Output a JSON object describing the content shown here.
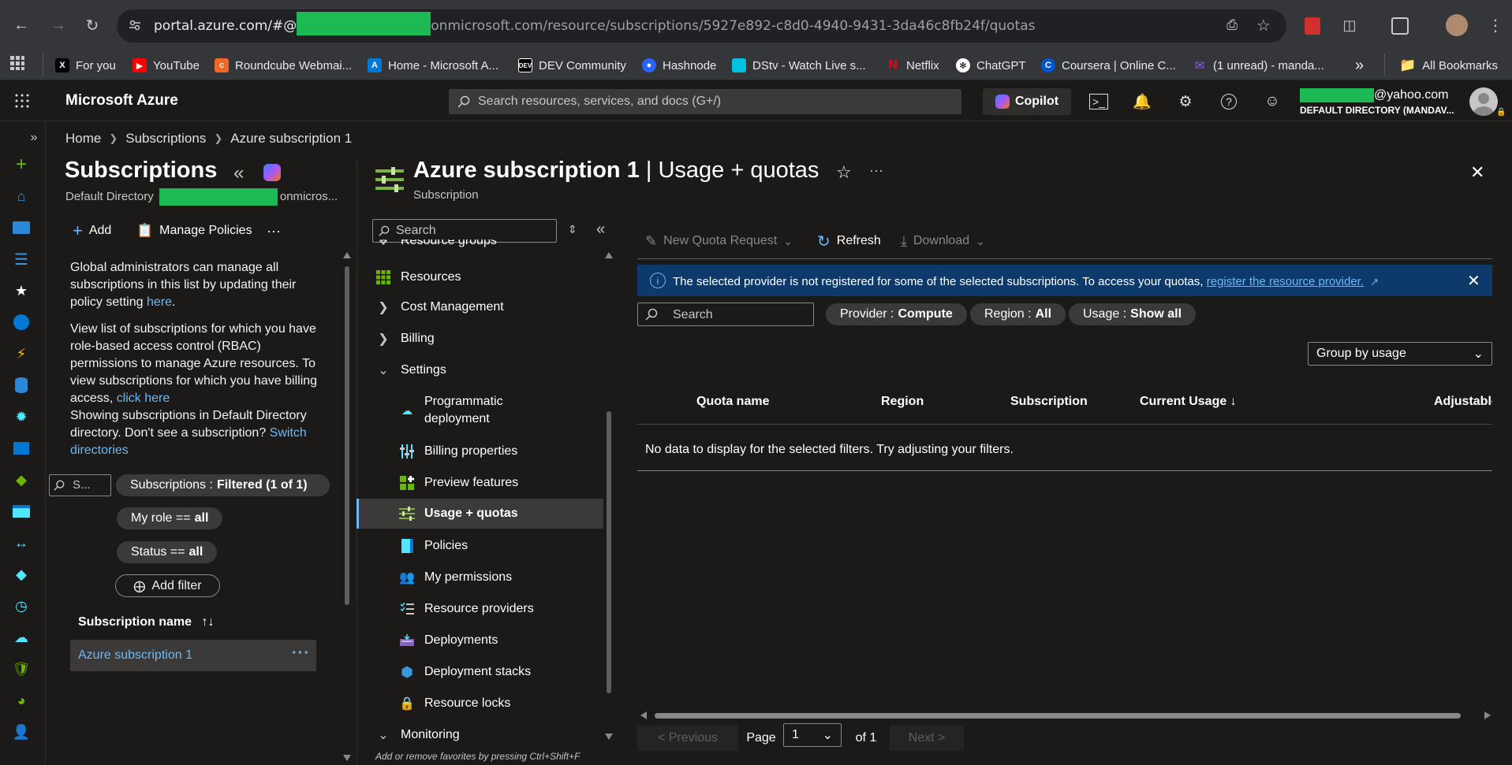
{
  "browser": {
    "url_prefix": "portal.azure.com/#@",
    "url_suffix": "onmicrosoft.com/resource/subscriptions/5927e892-c8d0-4940-9431-3da46c8fb24f/quotas",
    "bookmarks": [
      {
        "label": "For you"
      },
      {
        "label": "YouTube"
      },
      {
        "label": "Roundcube Webmai..."
      },
      {
        "label": "Home - Microsoft A..."
      },
      {
        "label": "DEV Community"
      },
      {
        "label": "Hashnode"
      },
      {
        "label": "DStv - Watch Live s..."
      },
      {
        "label": "Netflix"
      },
      {
        "label": "ChatGPT"
      },
      {
        "label": "Coursera | Online C..."
      },
      {
        "label": "(1 unread) - manda..."
      }
    ],
    "all_bookmarks": "All Bookmarks",
    "more_bookmarks": "»"
  },
  "azure_top": {
    "brand": "Microsoft Azure",
    "search_placeholder": "Search resources, services, and docs (G+/)",
    "copilot": "Copilot",
    "user_email": "@yahoo.com",
    "user_directory": "DEFAULT DIRECTORY (MANDAV..."
  },
  "breadcrumb": [
    "Home",
    "Subscriptions",
    "Azure subscription 1"
  ],
  "subscriptions_blade": {
    "title": "Subscriptions",
    "subtitle_prefix": "Default Directory",
    "subtitle_suffix": "onmicros...",
    "add": "Add",
    "manage_policies": "Manage Policies",
    "more": "···",
    "para1_a": "Global administrators can manage all subscriptions in this list by updating their policy setting ",
    "para1_link": "here",
    "para1_end": ".",
    "para2_a": "View list of subscriptions for which you have role-based access control (RBAC) permissions to manage Azure resources. To view subscriptions for which you have billing access, ",
    "para2_link": "click here",
    "para3_a": "Showing subscriptions in Default Directory directory. Don't see a subscription? ",
    "para3_link": "Switch directories",
    "search_placeholder": "S...",
    "filter_subs_label": "Subscriptions :",
    "filter_subs_value": "Filtered (1 of 1)",
    "filter_role_label": "My role ==",
    "filter_role_value": "all",
    "filter_status_label": "Status ==",
    "filter_status_value": "all",
    "add_filter": "Add filter",
    "col_name": "Subscription name",
    "sort_icon": "↑↓",
    "rows": [
      {
        "name": "Azure subscription 1"
      }
    ]
  },
  "resource_blade": {
    "title_strong": "Azure subscription 1",
    "title_rest": " | Usage + quotas",
    "subtitle": "Subscription",
    "menu_search_placeholder": "Search",
    "menu": {
      "resource_groups": "Resource groups",
      "resources": "Resources",
      "cost_management": "Cost Management",
      "billing": "Billing",
      "settings": "Settings",
      "programmatic_1": "Programmatic",
      "programmatic_2": "deployment",
      "billing_properties": "Billing properties",
      "preview_features": "Preview features",
      "usage_quotas": "Usage + quotas",
      "policies": "Policies",
      "my_permissions": "My permissions",
      "resource_providers": "Resource providers",
      "deployments": "Deployments",
      "deployment_stacks": "Deployment stacks",
      "resource_locks": "Resource locks",
      "monitoring": "Monitoring"
    },
    "hint": "Add or remove favorites by pressing Ctrl+Shift+F"
  },
  "main": {
    "toolbar": {
      "new_quota_request": "New Quota Request",
      "refresh": "Refresh",
      "download": "Download"
    },
    "banner": {
      "text": "The selected provider is not registered for some of the selected subscriptions. To access your quotas, ",
      "link": "register the resource provider."
    },
    "search_placeholder": "Search",
    "filters": {
      "provider_label": "Provider :",
      "provider_value": "Compute",
      "region_label": "Region :",
      "region_value": "All",
      "usage_label": "Usage :",
      "usage_value": "Show all"
    },
    "group_by": "Group by usage",
    "columns": [
      "Quota name",
      "Region",
      "Subscription",
      "Current Usage ↓",
      "Adjustable"
    ],
    "no_data": "No data to display for the selected filters. Try adjusting your filters.",
    "pager": {
      "previous": "< Previous",
      "page_label": "Page",
      "page_value": "1",
      "of": "of 1",
      "next": "Next >"
    }
  },
  "colors": {
    "accent": "#6cb8f6",
    "banner": "#0e3a6b",
    "redaction": "#1db954"
  }
}
